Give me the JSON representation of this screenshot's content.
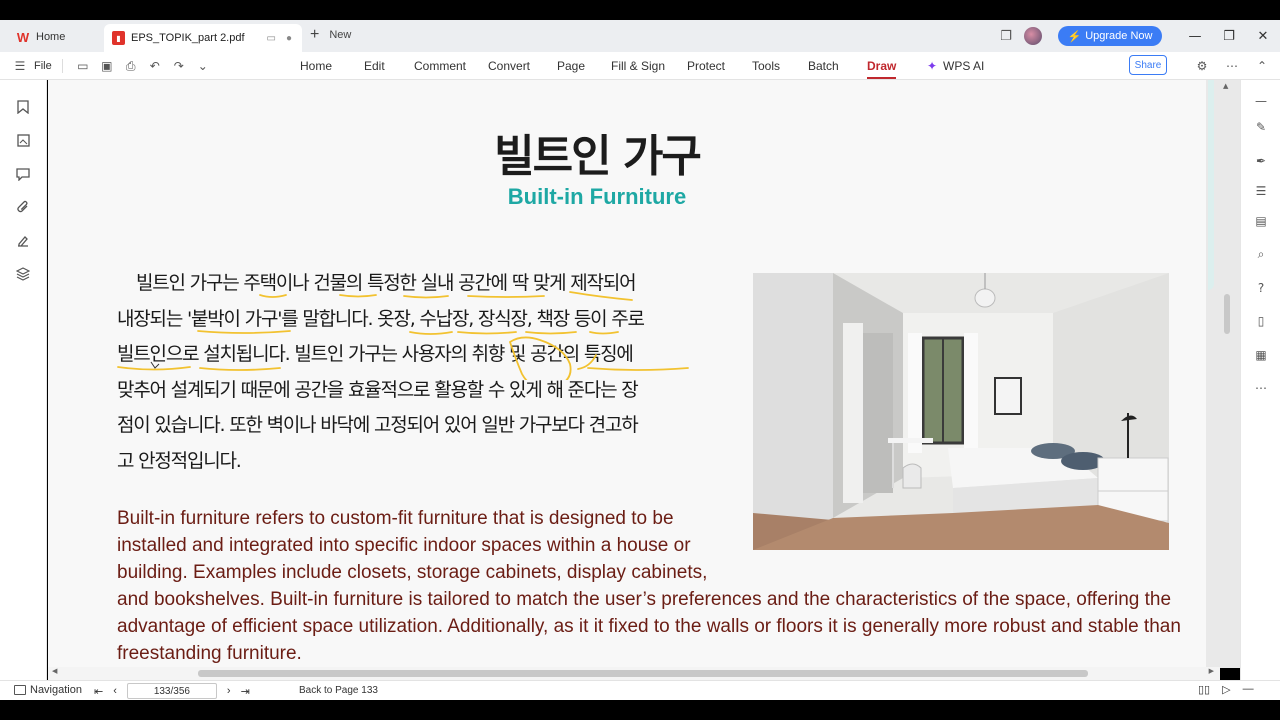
{
  "tabs": {
    "home_label": "Home",
    "doc_label": "EPS_TOPIK_part 2.pdf",
    "new_label": "New"
  },
  "header": {
    "upgrade_label": "Upgrade Now"
  },
  "toolbar": {
    "file_label": "File",
    "menu": [
      "Home",
      "Edit",
      "Comment",
      "Convert",
      "Page",
      "Fill & Sign",
      "Protect",
      "Tools",
      "Batch",
      "Draw",
      "WPS AI"
    ],
    "active_menu": "Draw",
    "share_label": "Share"
  },
  "document": {
    "title_ko": "빌트인 가구",
    "title_en": "Built-in Furniture",
    "ko_lines": [
      "빌트인 가구는 주택이나 건물의 특정한 실내 공간에 딱 맞게 제작되어",
      "내장되는 '붙박이 가구'를 말합니다. 옷장, 수납장, 장식장, 책장 등이 주로",
      "빌트인으로 설치됩니다. 빌트인 가구는 사용자의 취향 및 공간의 특징에",
      "맞추어 설계되기 때문에 공간을 효율적으로 활용할 수 있게 해 준다는 장",
      "점이 있습니다. 또한 벽이나 바닥에 고정되어 있어 일반 가구보다 견고하",
      "고 안정적입니다."
    ],
    "en_narrow_lines": [
      "Built-in furniture refers to custom-fit furniture that is designed to be",
      "installed and integrated into specific indoor spaces within a house or",
      "building. Examples include closets, storage cabinets, display cabinets,"
    ],
    "en_wide_lines": [
      "and bookshelves. Built-in furniture is tailored to match the user’s preferences and the characteristics of the space, offering the",
      "advantage of efficient space utilization. Additionally, as it it fixed to the walls or floors it is generally more robust and stable than",
      "freestanding furniture."
    ]
  },
  "statusbar": {
    "navigation_label": "Navigation",
    "page_value": "133/356",
    "back_label": "Back to Page 133"
  },
  "colors": {
    "accent_red": "#c0282e",
    "title_teal": "#1ea8a4",
    "english_text": "#6b1d14",
    "underline_yellow": "#f2c230",
    "upgrade_blue": "#3b7cf5"
  }
}
